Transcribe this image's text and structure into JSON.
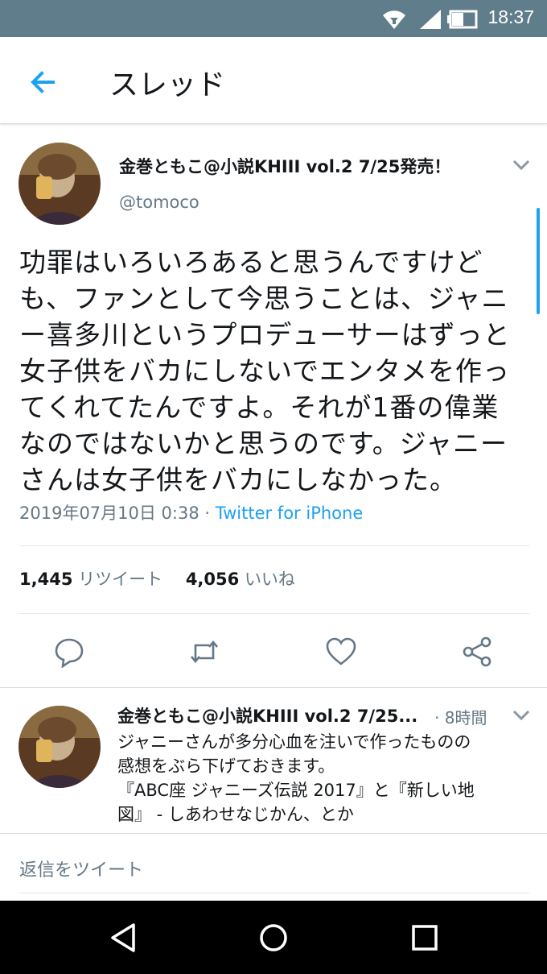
{
  "status_bar": {
    "time": "18:37",
    "icons": [
      "wifi-icon",
      "signal-icon",
      "battery-icon"
    ]
  },
  "header": {
    "back_icon": "arrow-left-icon",
    "title": "スレッド"
  },
  "main_tweet": {
    "display_name": "金巻ともこ@小説KHIII vol.2 7/25発売！",
    "handle": "@tomoco",
    "text_lines": [
      "功罪はいろいろあると思うんですけど",
      "も、ファンとして今思うことは、ジャニ",
      "ー喜多川というプロデューサーはずっと",
      "女子供をバカにしないでエンタメを作っ",
      "てくれてたんですよ。それが1番の偉業",
      "なのではないかと思うのです。ジャニー",
      "さんは女子供をバカにしなかった。"
    ],
    "timestamp": "2019年07月10日 0:38 · ",
    "source": "Twitter for iPhone",
    "retweets_count": "1,445",
    "retweets_label": "リツイート",
    "likes_count": "4,056",
    "likes_label": "いいね",
    "actions": [
      "reply-icon",
      "retweet-icon",
      "like-icon",
      "share-icon"
    ]
  },
  "reply_tweet": {
    "display_name": "金巻ともこ@小説KHIII vol.2 7/25...",
    "time": "· 8時間",
    "text_lines": [
      "ジャニーさんが多分心血を注いで作ったものの",
      "感想をぶら下げておきます。",
      "『ABC座 ジャニーズ伝説 2017』と『新しい地",
      "図』 - しあわせなじかん、とか"
    ]
  },
  "compose": {
    "placeholder": "返信をツイート"
  },
  "nav_bar": {
    "icons": [
      "back-triangle-icon",
      "home-circle-icon",
      "recents-square-icon"
    ]
  },
  "colors": {
    "status_bar": "#607d8b",
    "accent": "#1da1f2",
    "text": "#14171a",
    "muted": "#657786"
  }
}
